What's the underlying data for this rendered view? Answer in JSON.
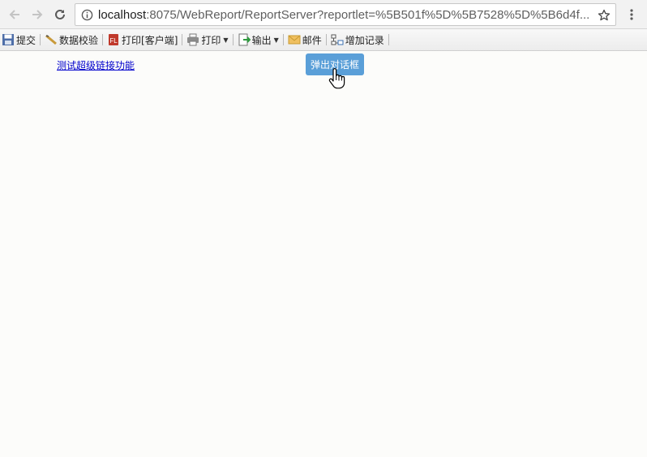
{
  "browser": {
    "url_host": "localhost",
    "url_rest": ":8075/WebReport/ReportServer?reportlet=%5B501f%5D%5B7528%5D%5B6d4f...",
    "back_icon": "arrow-left-icon",
    "forward_icon": "arrow-right-icon",
    "reload_icon": "reload-icon",
    "info_icon": "info-icon",
    "bookmark_icon": "star-icon",
    "menu_icon": "three-dots-vertical-icon"
  },
  "toolbar": {
    "submit_label": "提交",
    "validate_label": "数据校验",
    "print_client_label": "打印[客户端]",
    "print_label": "打印",
    "export_label": "输出",
    "mail_label": "邮件",
    "add_record_label": "增加记录"
  },
  "content": {
    "hyperlink_text": "测试超级链接功能",
    "dialog_button_label": "弹出对话框"
  },
  "colors": {
    "dialog_button_bg": "#5a9fd8",
    "link_color": "#0000cc"
  }
}
